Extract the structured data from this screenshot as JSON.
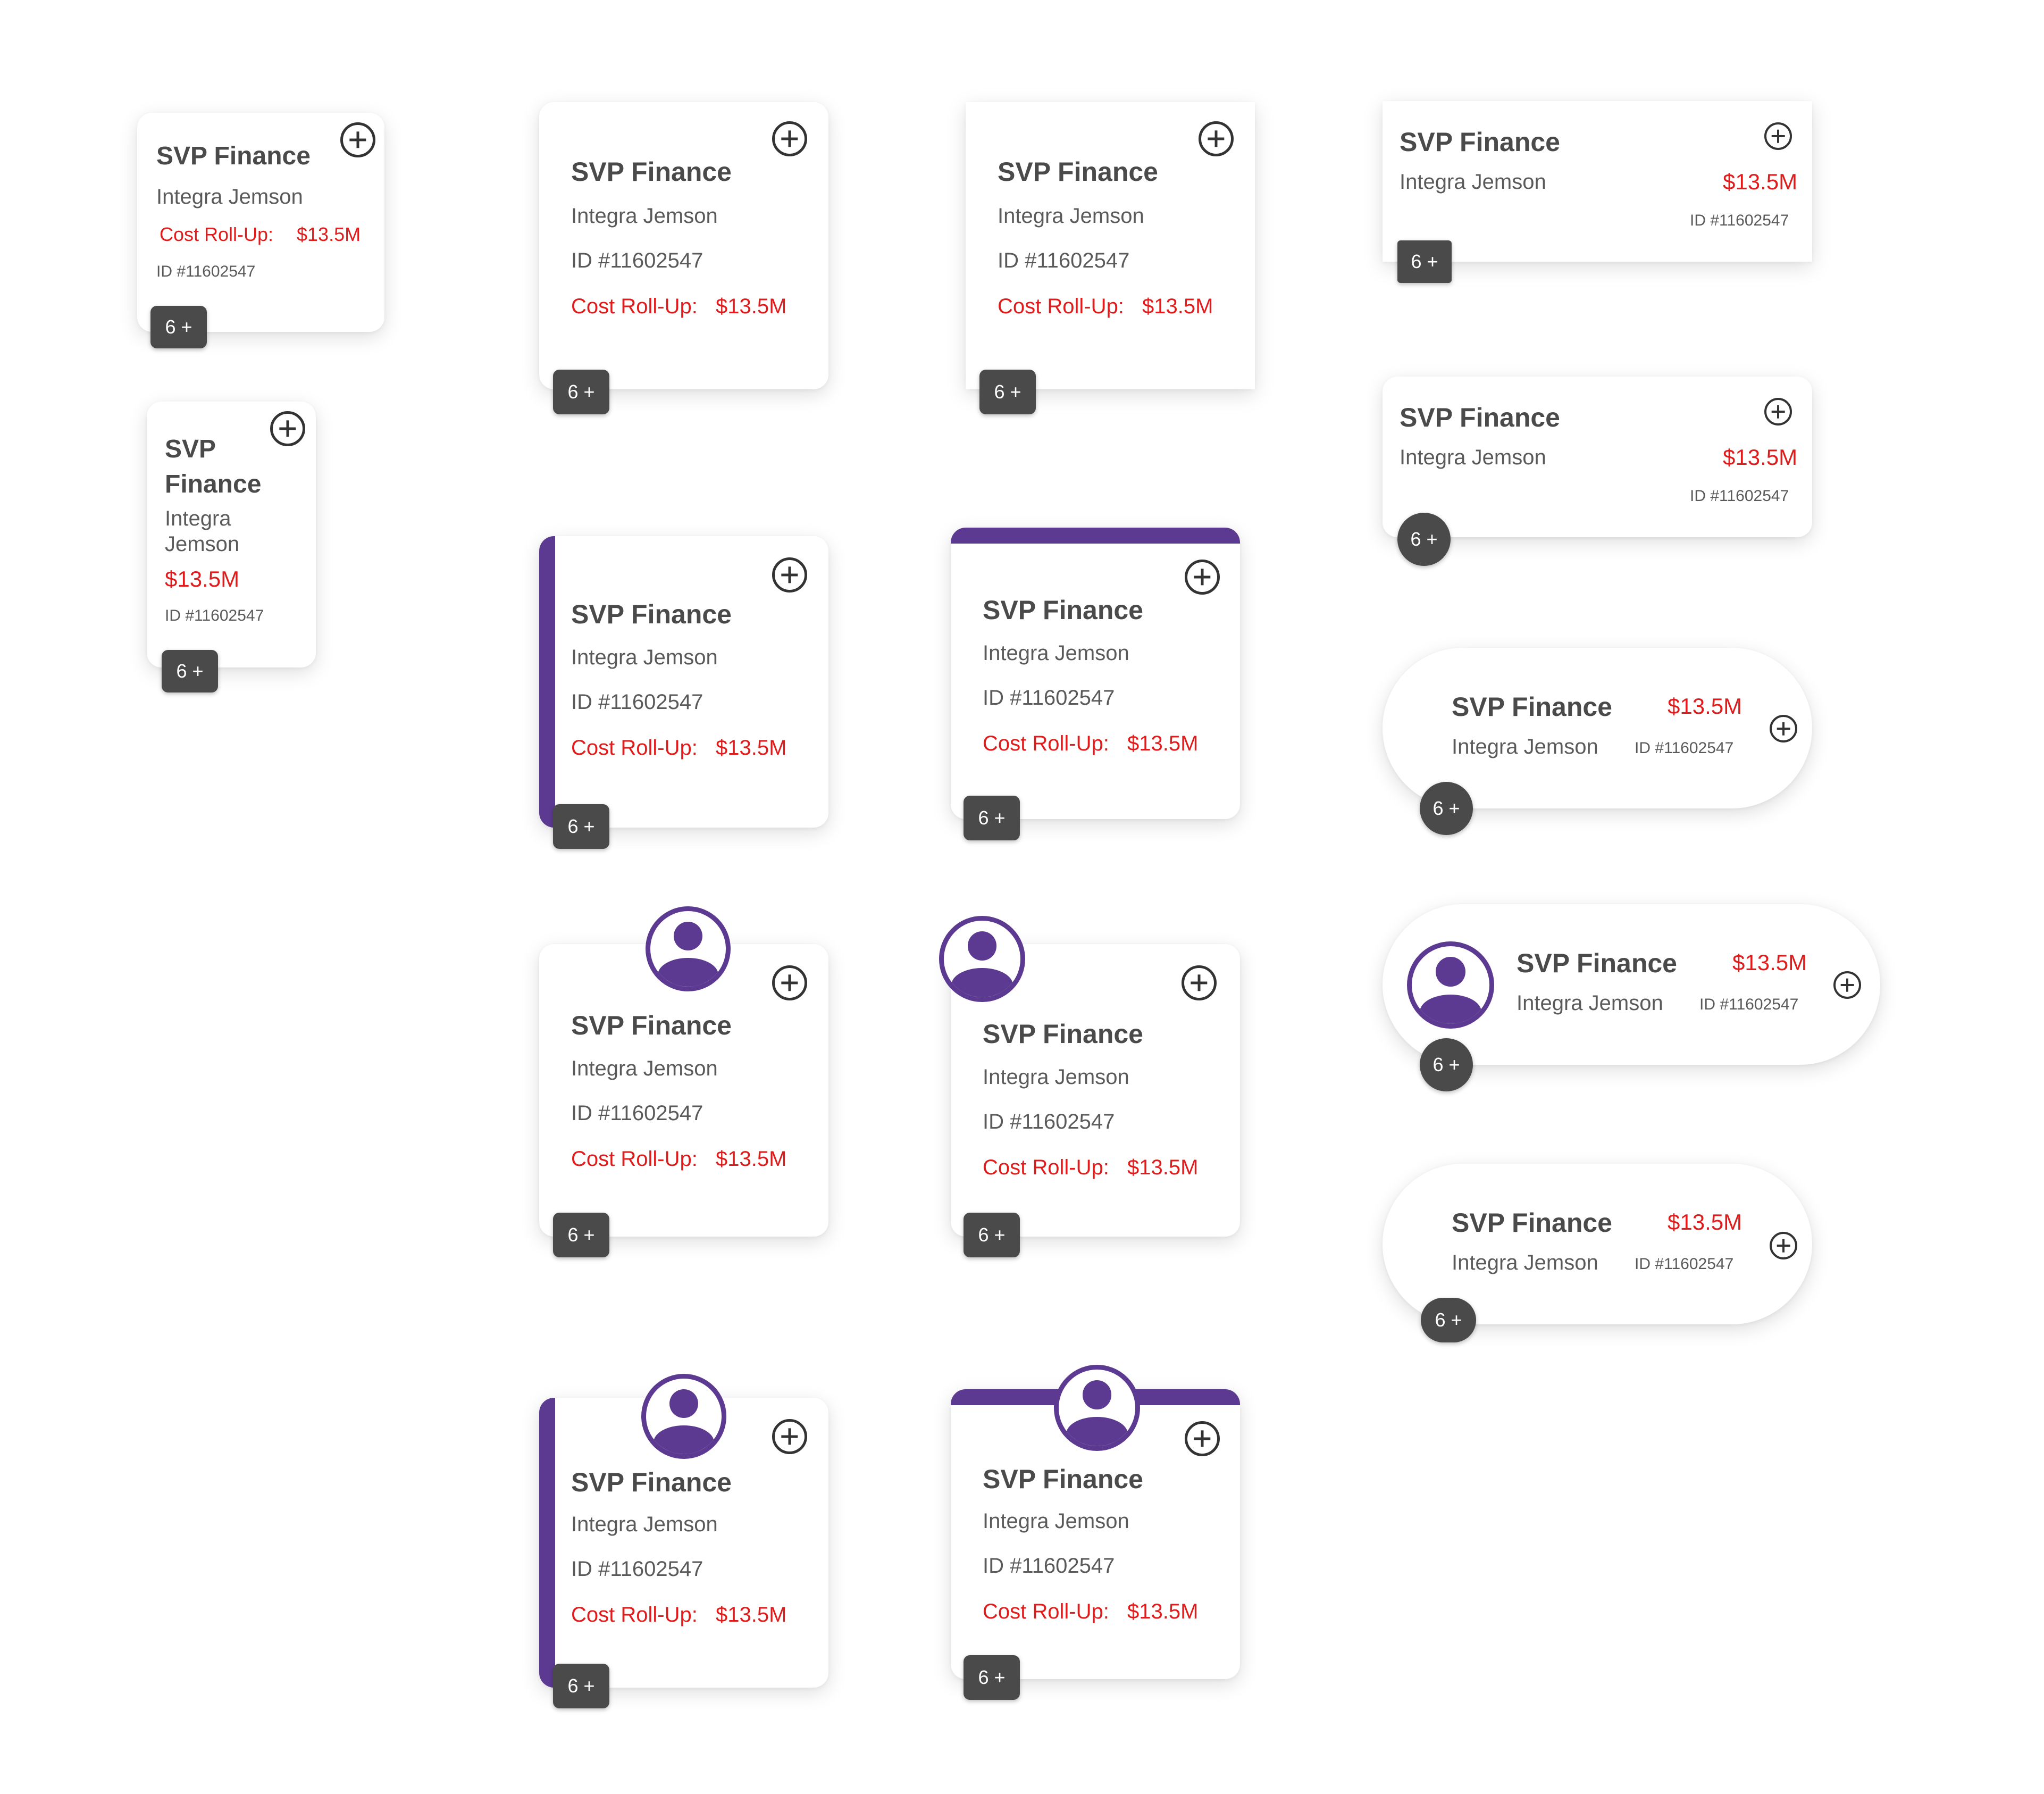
{
  "card": {
    "title": "SVP Finance",
    "title_line1": "SVP",
    "title_line2": "Finance",
    "name": "Integra Jemson",
    "name_line1": "Integra",
    "name_line2": "Jemson",
    "id_label": "ID #11602547",
    "cost_label": "Cost Roll-Up:",
    "cost_value": "$13.5M",
    "badge": "6 +"
  },
  "icons": {
    "add": "plus-circle-icon",
    "avatar": "user-avatar-icon"
  },
  "colors": {
    "accent": "#5c3a92",
    "cost": "#e01b1b",
    "badge_bg": "#4a4a4a",
    "title": "#4a4a4a"
  }
}
